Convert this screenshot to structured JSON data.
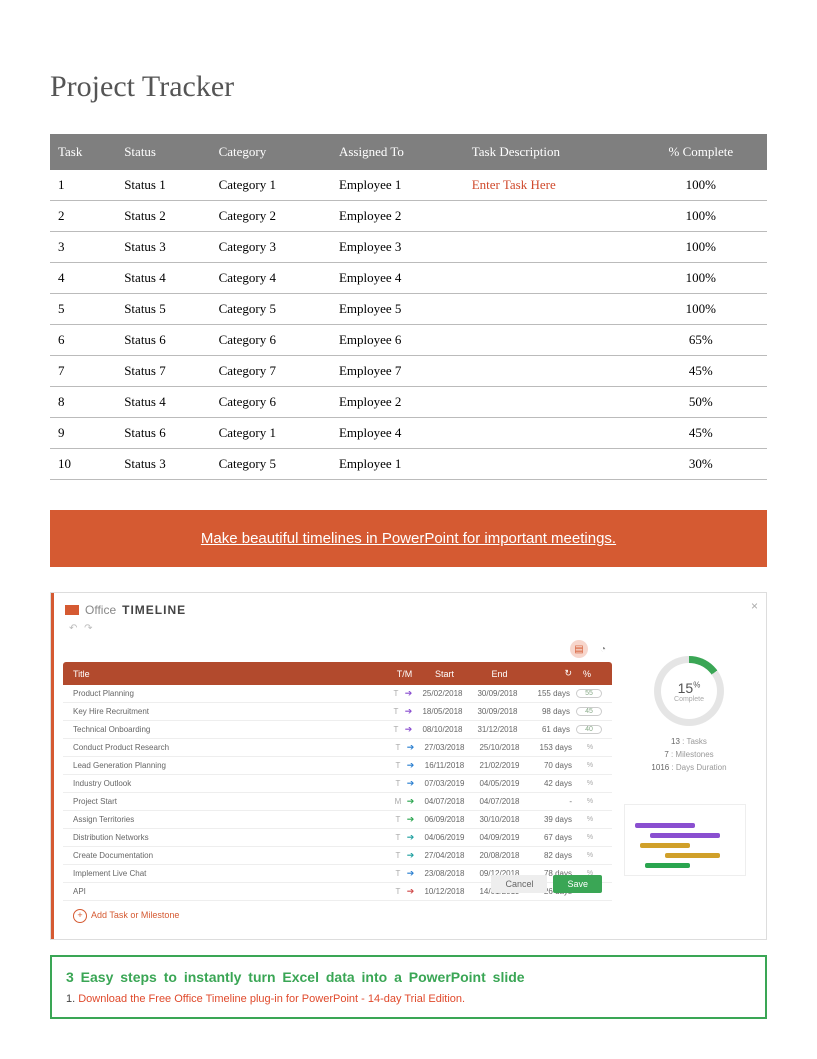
{
  "title": "Project Tracker",
  "columns": {
    "task": "Task",
    "status": "Status",
    "category": "Category",
    "assigned": "Assigned To",
    "desc": "Task Description",
    "pct": "% Complete"
  },
  "rows": [
    {
      "task": "1",
      "status": "Status 1",
      "category": "Category 1",
      "assigned": "Employee 1",
      "desc": "Enter Task Here",
      "pct": "100%"
    },
    {
      "task": "2",
      "status": "Status 2",
      "category": "Category 2",
      "assigned": "Employee 2",
      "desc": "",
      "pct": "100%"
    },
    {
      "task": "3",
      "status": "Status 3",
      "category": "Category 3",
      "assigned": "Employee 3",
      "desc": "",
      "pct": "100%"
    },
    {
      "task": "4",
      "status": "Status 4",
      "category": "Category 4",
      "assigned": "Employee 4",
      "desc": "",
      "pct": "100%"
    },
    {
      "task": "5",
      "status": "Status 5",
      "category": "Category 5",
      "assigned": "Employee 5",
      "desc": "",
      "pct": "100%"
    },
    {
      "task": "6",
      "status": "Status 6",
      "category": "Category 6",
      "assigned": "Employee 6",
      "desc": "",
      "pct": "65%"
    },
    {
      "task": "7",
      "status": "Status 7",
      "category": "Category 7",
      "assigned": "Employee 7",
      "desc": "",
      "pct": "45%"
    },
    {
      "task": "8",
      "status": "Status 4",
      "category": "Category 6",
      "assigned": "Employee 2",
      "desc": "",
      "pct": "50%"
    },
    {
      "task": "9",
      "status": "Status 6",
      "category": "Category 1",
      "assigned": "Employee 4",
      "desc": "",
      "pct": "45%"
    },
    {
      "task": "10",
      "status": "Status 3",
      "category": "Category 5",
      "assigned": "Employee 1",
      "desc": "",
      "pct": "30%"
    }
  ],
  "banner": "Make beautiful timelines in PowerPoint for important meetings.",
  "ot": {
    "brand1": "Office",
    "brand2": "TIMELINE",
    "header": {
      "title": "Title",
      "tm": "T/M",
      "start": "Start",
      "end": "End",
      "dur": "↻",
      "pct": "%"
    },
    "rows": [
      {
        "title": "Product Planning",
        "tm": "T",
        "color": "c-purple",
        "start": "25/02/2018",
        "end": "30/09/2018",
        "dur": "155 days",
        "pct": "55"
      },
      {
        "title": "Key Hire Recruitment",
        "tm": "T",
        "color": "c-purple",
        "start": "18/05/2018",
        "end": "30/09/2018",
        "dur": "98 days",
        "pct": "45"
      },
      {
        "title": "Technical Onboarding",
        "tm": "T",
        "color": "c-purple",
        "start": "08/10/2018",
        "end": "31/12/2018",
        "dur": "61 days",
        "pct": "40"
      },
      {
        "title": "Conduct Product Research",
        "tm": "T",
        "color": "c-blue",
        "start": "27/03/2018",
        "end": "25/10/2018",
        "dur": "153 days",
        "pct": ""
      },
      {
        "title": "Lead Generation Planning",
        "tm": "T",
        "color": "c-blue",
        "start": "16/11/2018",
        "end": "21/02/2019",
        "dur": "70 days",
        "pct": ""
      },
      {
        "title": "Industry Outlook",
        "tm": "T",
        "color": "c-blue",
        "start": "07/03/2019",
        "end": "04/05/2019",
        "dur": "42 days",
        "pct": ""
      },
      {
        "title": "Project Start",
        "tm": "M",
        "color": "c-green",
        "start": "04/07/2018",
        "end": "04/07/2018",
        "dur": "-",
        "pct": ""
      },
      {
        "title": "Assign Territories",
        "tm": "T",
        "color": "c-green",
        "start": "06/09/2018",
        "end": "30/10/2018",
        "dur": "39 days",
        "pct": ""
      },
      {
        "title": "Distribution Networks",
        "tm": "T",
        "color": "c-teal",
        "start": "04/06/2019",
        "end": "04/09/2019",
        "dur": "67 days",
        "pct": ""
      },
      {
        "title": "Create Documentation",
        "tm": "T",
        "color": "c-teal",
        "start": "27/04/2018",
        "end": "20/08/2018",
        "dur": "82 days",
        "pct": ""
      },
      {
        "title": "Implement Live Chat",
        "tm": "T",
        "color": "c-blue",
        "start": "23/08/2018",
        "end": "09/12/2018",
        "dur": "78 days",
        "pct": ""
      },
      {
        "title": "API",
        "tm": "T",
        "color": "c-red",
        "start": "10/12/2018",
        "end": "14/01/2019",
        "dur": "26 days",
        "pct": ""
      }
    ],
    "add": "Add Task or Milestone",
    "cancel": "Cancel",
    "save": "Save",
    "ring": {
      "val": "15",
      "unit": "%",
      "label": "Complete"
    },
    "stats": [
      {
        "n": "13",
        "l": "Tasks"
      },
      {
        "n": "7",
        "l": "Milestones"
      },
      {
        "n": "1016",
        "l": "Days Duration"
      }
    ]
  },
  "instruct": {
    "heading": "3 Easy steps to instantly turn Excel data into a PowerPoint slide",
    "step1_num": "1. ",
    "step1_text": "Download the Free Office Timeline plug-in for PowerPoint - 14-day Trial Edition."
  }
}
